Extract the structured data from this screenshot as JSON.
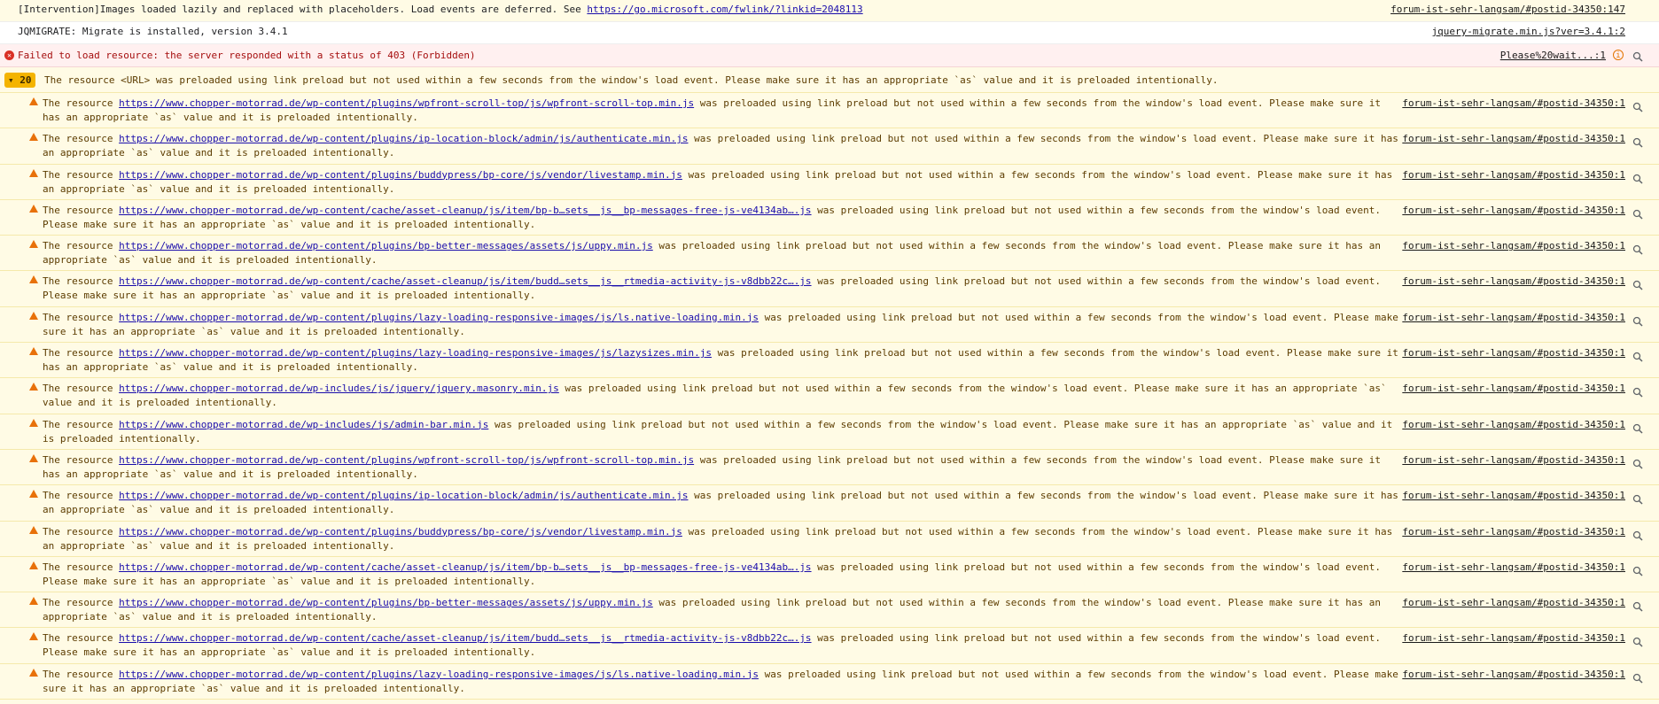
{
  "intervention": {
    "text": "[Intervention]Images loaded lazily and replaced with placeholders. Load events are deferred. See ",
    "link": "https://go.microsoft.com/fwlink/?linkid=2048113",
    "source": "forum-ist-sehr-langsam/#postid-34350:147"
  },
  "jqmigrate": {
    "text": "JQMIGRATE: Migrate is installed, version 3.4.1",
    "source": "jquery-migrate.min.js?ver=3.4.1:2"
  },
  "error": {
    "text": "Failed to load resource: the server responded with a status of 403 (Forbidden)",
    "source": "Please%20wait...:1",
    "icon": "error-icon"
  },
  "group": {
    "count": "20",
    "text": "The resource <URL> was preloaded using link preload but not used within a few seconds from the window's load event. Please make sure it has an appropriate `as` value and it is preloaded intentionally."
  },
  "warn_prefix": "The resource ",
  "warn_suffix": " was preloaded using link preload but not used within a few seconds from the window's load event. Please make sure it has an appropriate `as` value and it is preloaded intentionally.",
  "warn_source": "forum-ist-sehr-langsam/#postid-34350:1",
  "warnings": [
    {
      "url": "https://www.chopper-motorrad.de/wp-content/plugins/wpfront-scroll-top/js/wpfront-scroll-top.min.js"
    },
    {
      "url": "https://www.chopper-motorrad.de/wp-content/plugins/ip-location-block/admin/js/authenticate.min.js"
    },
    {
      "url": "https://www.chopper-motorrad.de/wp-content/plugins/buddypress/bp-core/js/vendor/livestamp.min.js"
    },
    {
      "url": "https://www.chopper-motorrad.de/wp-content/cache/asset-cleanup/js/item/bp-b…sets__js__bp-messages-free-js-ve4134ab….js"
    },
    {
      "url": "https://www.chopper-motorrad.de/wp-content/plugins/bp-better-messages/assets/js/uppy.min.js"
    },
    {
      "url": "https://www.chopper-motorrad.de/wp-content/cache/asset-cleanup/js/item/budd…sets__js__rtmedia-activity-js-v8dbb22c….js"
    },
    {
      "url": "https://www.chopper-motorrad.de/wp-content/plugins/lazy-loading-responsive-images/js/ls.native-loading.min.js"
    },
    {
      "url": "https://www.chopper-motorrad.de/wp-content/plugins/lazy-loading-responsive-images/js/lazysizes.min.js"
    },
    {
      "url": "https://www.chopper-motorrad.de/wp-includes/js/jquery/jquery.masonry.min.js"
    },
    {
      "url": "https://www.chopper-motorrad.de/wp-includes/js/admin-bar.min.js"
    },
    {
      "url": "https://www.chopper-motorrad.de/wp-content/plugins/wpfront-scroll-top/js/wpfront-scroll-top.min.js"
    },
    {
      "url": "https://www.chopper-motorrad.de/wp-content/plugins/ip-location-block/admin/js/authenticate.min.js"
    },
    {
      "url": "https://www.chopper-motorrad.de/wp-content/plugins/buddypress/bp-core/js/vendor/livestamp.min.js"
    },
    {
      "url": "https://www.chopper-motorrad.de/wp-content/cache/asset-cleanup/js/item/bp-b…sets__js__bp-messages-free-js-ve4134ab….js"
    },
    {
      "url": "https://www.chopper-motorrad.de/wp-content/plugins/bp-better-messages/assets/js/uppy.min.js"
    },
    {
      "url": "https://www.chopper-motorrad.de/wp-content/cache/asset-cleanup/js/item/budd…sets__js__rtmedia-activity-js-v8dbb22c….js"
    },
    {
      "url": "https://www.chopper-motorrad.de/wp-content/plugins/lazy-loading-responsive-images/js/ls.native-loading.min.js"
    }
  ]
}
